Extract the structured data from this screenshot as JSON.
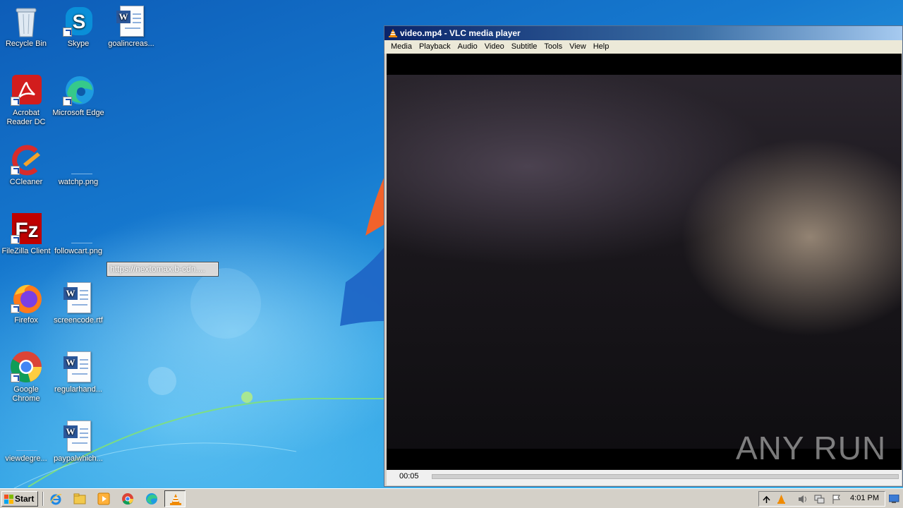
{
  "desktop": {
    "icons": [
      {
        "label": "Recycle Bin",
        "icon": "recycle-bin-icon"
      },
      {
        "label": "Skype",
        "icon": "skype-icon"
      },
      {
        "label": "goalincreas...",
        "icon": "word-document-icon"
      },
      {
        "label": "Acrobat Reader DC",
        "icon": "acrobat-icon"
      },
      {
        "label": "Microsoft Edge",
        "icon": "edge-icon"
      },
      {
        "label": "CCleaner",
        "icon": "ccleaner-icon"
      },
      {
        "label": "watchp.png",
        "icon": "image-file-icon"
      },
      {
        "label": "FileZilla Client",
        "icon": "filezilla-icon"
      },
      {
        "label": "followcart.png",
        "icon": "image-file-icon"
      },
      {
        "label": "Firefox",
        "icon": "firefox-icon"
      },
      {
        "label": "screencode.rtf",
        "icon": "word-document-icon"
      },
      {
        "label": "Google Chrome",
        "icon": "chrome-icon"
      },
      {
        "label": "regularhand...",
        "icon": "word-document-icon"
      },
      {
        "label": "viewdegre...",
        "icon": "image-file-icon"
      },
      {
        "label": "paypalwhich...",
        "icon": "word-document-icon"
      }
    ],
    "tooltip": "https://nextomax.b-cdn...."
  },
  "vlc": {
    "title": "video.mp4 - VLC media player",
    "menu": [
      "Media",
      "Playback",
      "Audio",
      "Video",
      "Subtitle",
      "Tools",
      "View",
      "Help"
    ],
    "time": "00:05",
    "progress": 0.0,
    "watermark": "ANY RUN"
  },
  "taskbar": {
    "start_label": "Start",
    "pinned": [
      "internet-explorer-icon",
      "file-explorer-icon",
      "media-player-icon",
      "chrome-icon",
      "edge-icon",
      "vlc-icon"
    ],
    "tray_icons": [
      "show-hidden-icon",
      "vlc-icon",
      "volume-icon",
      "network-icon",
      "action-center-flag-icon"
    ],
    "clock": "4:01 PM"
  },
  "colors": {
    "title_bar": "#0a246a",
    "desktop_blue": "#1679cf",
    "vlc_orange": "#f08a00"
  }
}
